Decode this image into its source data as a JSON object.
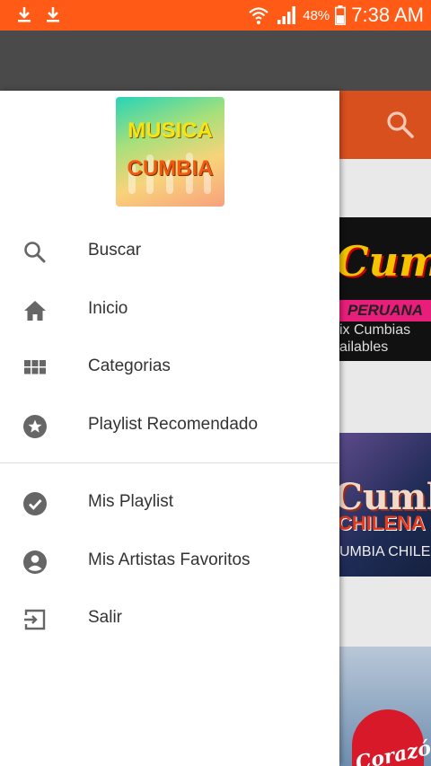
{
  "status_bar": {
    "battery_percent": "48%",
    "time": "7:38 AM",
    "bg_color": "#ff5a16"
  },
  "background_app": {
    "tiles": [
      {
        "title_art": "Cumbia",
        "banner": "PERUANA",
        "caption": "ix Cumbias\nailables"
      },
      {
        "title_art": "Cumbia",
        "banner": "CHILENA",
        "caption": "UMBIA CHILEN"
      },
      {
        "title_art": "Corazón Serrano"
      }
    ]
  },
  "drawer": {
    "logo": {
      "line1": "MUSICA",
      "line2": "CUMBIA"
    },
    "menu_primary": [
      {
        "label": "Buscar",
        "icon": "search-icon"
      },
      {
        "label": "Inicio",
        "icon": "home-icon"
      },
      {
        "label": "Categorias",
        "icon": "grid-icon"
      },
      {
        "label": "Playlist Recomendado",
        "icon": "star-icon"
      }
    ],
    "menu_secondary": [
      {
        "label": "Mis Playlist",
        "icon": "check-circle-icon"
      },
      {
        "label": "Mis Artistas Favoritos",
        "icon": "account-circle-icon"
      },
      {
        "label": "Salir",
        "icon": "exit-icon"
      }
    ]
  }
}
